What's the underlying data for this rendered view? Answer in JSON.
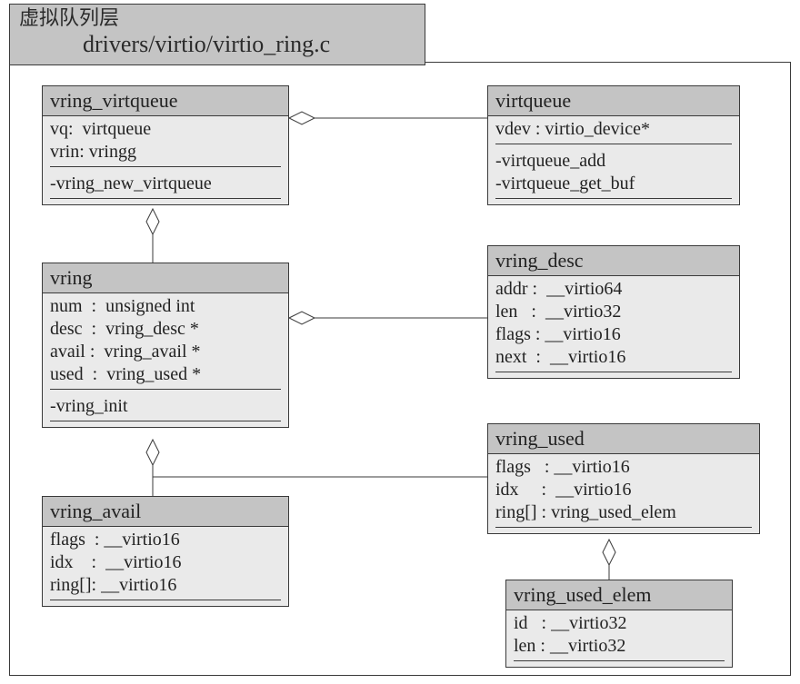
{
  "package": {
    "zh_label": "虚拟队列层",
    "path": "drivers/virtio/virtio_ring.c"
  },
  "classes": {
    "vring_virtqueue": {
      "title": "vring_virtqueue",
      "attrs": [
        "vq:  virtqueue",
        "vrin: vringg"
      ],
      "ops": [
        "-vring_new_virtqueue"
      ]
    },
    "virtqueue": {
      "title": "virtqueue",
      "attrs": [
        "vdev : virtio_device*"
      ],
      "ops": [
        "-virtqueue_add",
        "-virtqueue_get_buf"
      ]
    },
    "vring": {
      "title": "vring",
      "attrs": [
        "num  :  unsigned int",
        "desc  :  vring_desc *",
        "avail :  vring_avail *",
        "used  :  vring_used *"
      ],
      "ops": [
        "-vring_init"
      ]
    },
    "vring_desc": {
      "title": "vring_desc",
      "attrs": [
        "addr :  __virtio64",
        "len   :  __virtio32",
        "flags : __virtio16",
        "next  :  __virtio16"
      ]
    },
    "vring_avail": {
      "title": "vring_avail",
      "attrs": [
        "flags  : __virtio16",
        "idx    :  __virtio16",
        "ring[]: __virtio16"
      ]
    },
    "vring_used": {
      "title": "vring_used",
      "attrs": [
        "flags   : __virtio16",
        "idx     :  __virtio16",
        "ring[] : vring_used_elem"
      ]
    },
    "vring_used_elem": {
      "title": "vring_used_elem",
      "attrs": [
        "id   : __virtio32",
        "len : __virtio32"
      ]
    }
  }
}
